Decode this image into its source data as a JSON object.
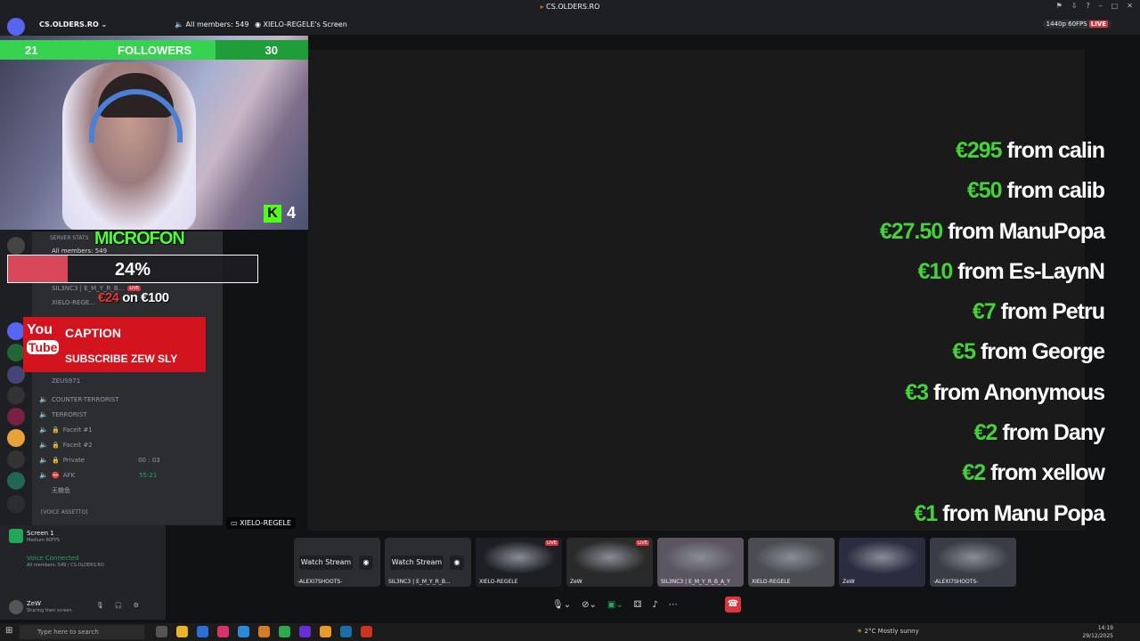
{
  "window": {
    "title": "CS.OLDERS.RO"
  },
  "topbar": {
    "server_name": "CS.OLDERS.RO",
    "members": "All members: 549",
    "screen_label": "XIELO-REGELE's Screen",
    "quality": "1440p 60FPS",
    "quality_live": "LIVE"
  },
  "webcam": {
    "followers_left": "21",
    "followers_label": "FOLLOWERS",
    "followers_right": "30",
    "followers_progress": 0.7,
    "kick_count": "4"
  },
  "overlay": {
    "mic_label": "MICROFON",
    "goal_percent": "24%",
    "goal_fill": 0.24,
    "goal_current": "€24",
    "goal_sep": " on ",
    "goal_target": "€100",
    "yt_you": "You",
    "yt_tube": "Tube",
    "yt_caption": "CAPTION",
    "yt_subscribe": "SUBSCRIBE ZEW SLY"
  },
  "sidebar": {
    "server_stats": "SERVER STATS",
    "members_small": "All members: 549",
    "sub_users": [
      {
        "name": "SIL3NC3 | E_M_Y_R_B...",
        "badge": "LIVE"
      },
      {
        "name": "XIELO-REGE...",
        "badge": "LIVE"
      },
      {
        "name": "ZEUS971",
        "badge": ""
      }
    ],
    "channels": [
      {
        "name": "COUNTER-TERRORIST",
        "locked": false
      },
      {
        "name": "TERRORIST",
        "locked": false
      },
      {
        "name": "Faceit #1",
        "locked": true
      },
      {
        "name": "Faceit #2",
        "locked": true
      },
      {
        "name": "Private",
        "locked": true
      },
      {
        "name": "AFK",
        "locked": false
      }
    ],
    "afk_user": "无糖鱼",
    "private_timer": "00 : 03",
    "afk_timer": "55:21",
    "voice_assetto": "[VOICE ASSETTO]"
  },
  "userpanel": {
    "screen_title": "Screen 1",
    "screen_sub": "Medium 60FPS",
    "voice_status": "Voice Connected",
    "voice_sub": "All members: 549 / CS.OLDERS.RO",
    "user_name": "ZeW",
    "user_status": "Sharing their screen"
  },
  "donations": [
    {
      "amount": "€295",
      "from": " from calin"
    },
    {
      "amount": "€50",
      "from": " from calib"
    },
    {
      "amount": "€27.50",
      "from": " from ManuPopa"
    },
    {
      "amount": "€10",
      "from": " from Es-LaynN"
    },
    {
      "amount": "€7",
      "from": " from Petru"
    },
    {
      "amount": "€5",
      "from": " from George"
    },
    {
      "amount": "€3",
      "from": " from Anonymous"
    },
    {
      "amount": "€2",
      "from": " from Dany"
    },
    {
      "amount": "€2",
      "from": " from xellow"
    },
    {
      "amount": "€1",
      "from": " from Manu Popa"
    }
  ],
  "stream_tag": "XIELO-REGELE",
  "thumbnails": [
    {
      "type": "watch",
      "label": "Watch Stream",
      "name": "-ALEXI7SHOOTS-"
    },
    {
      "type": "watch",
      "label": "Watch Stream",
      "name": "SIL3NC3 | E_M_Y_R_B..."
    },
    {
      "type": "video",
      "name": "XIELO-REGELE",
      "live": "LIVE"
    },
    {
      "type": "video",
      "name": "ZeW",
      "live": "LIVE"
    },
    {
      "type": "video",
      "name": "SIL3NC3 | E_M_Y_R_B_A_Y"
    },
    {
      "type": "video",
      "name": "XIELO-REGELE"
    },
    {
      "type": "video",
      "name": "ZeW"
    },
    {
      "type": "video",
      "name": "-ALEXI7SHOOTS-"
    }
  ],
  "taskbar": {
    "search_placeholder": "Type here to search",
    "weather": "2°C  Mostly sunny",
    "time": "14:19",
    "date": "29/12/2025"
  },
  "colors": {
    "donation_amount": "#45d13a",
    "followers_bar": "#37d24f",
    "yt_red": "#d3131e",
    "live_red": "#da373c"
  }
}
